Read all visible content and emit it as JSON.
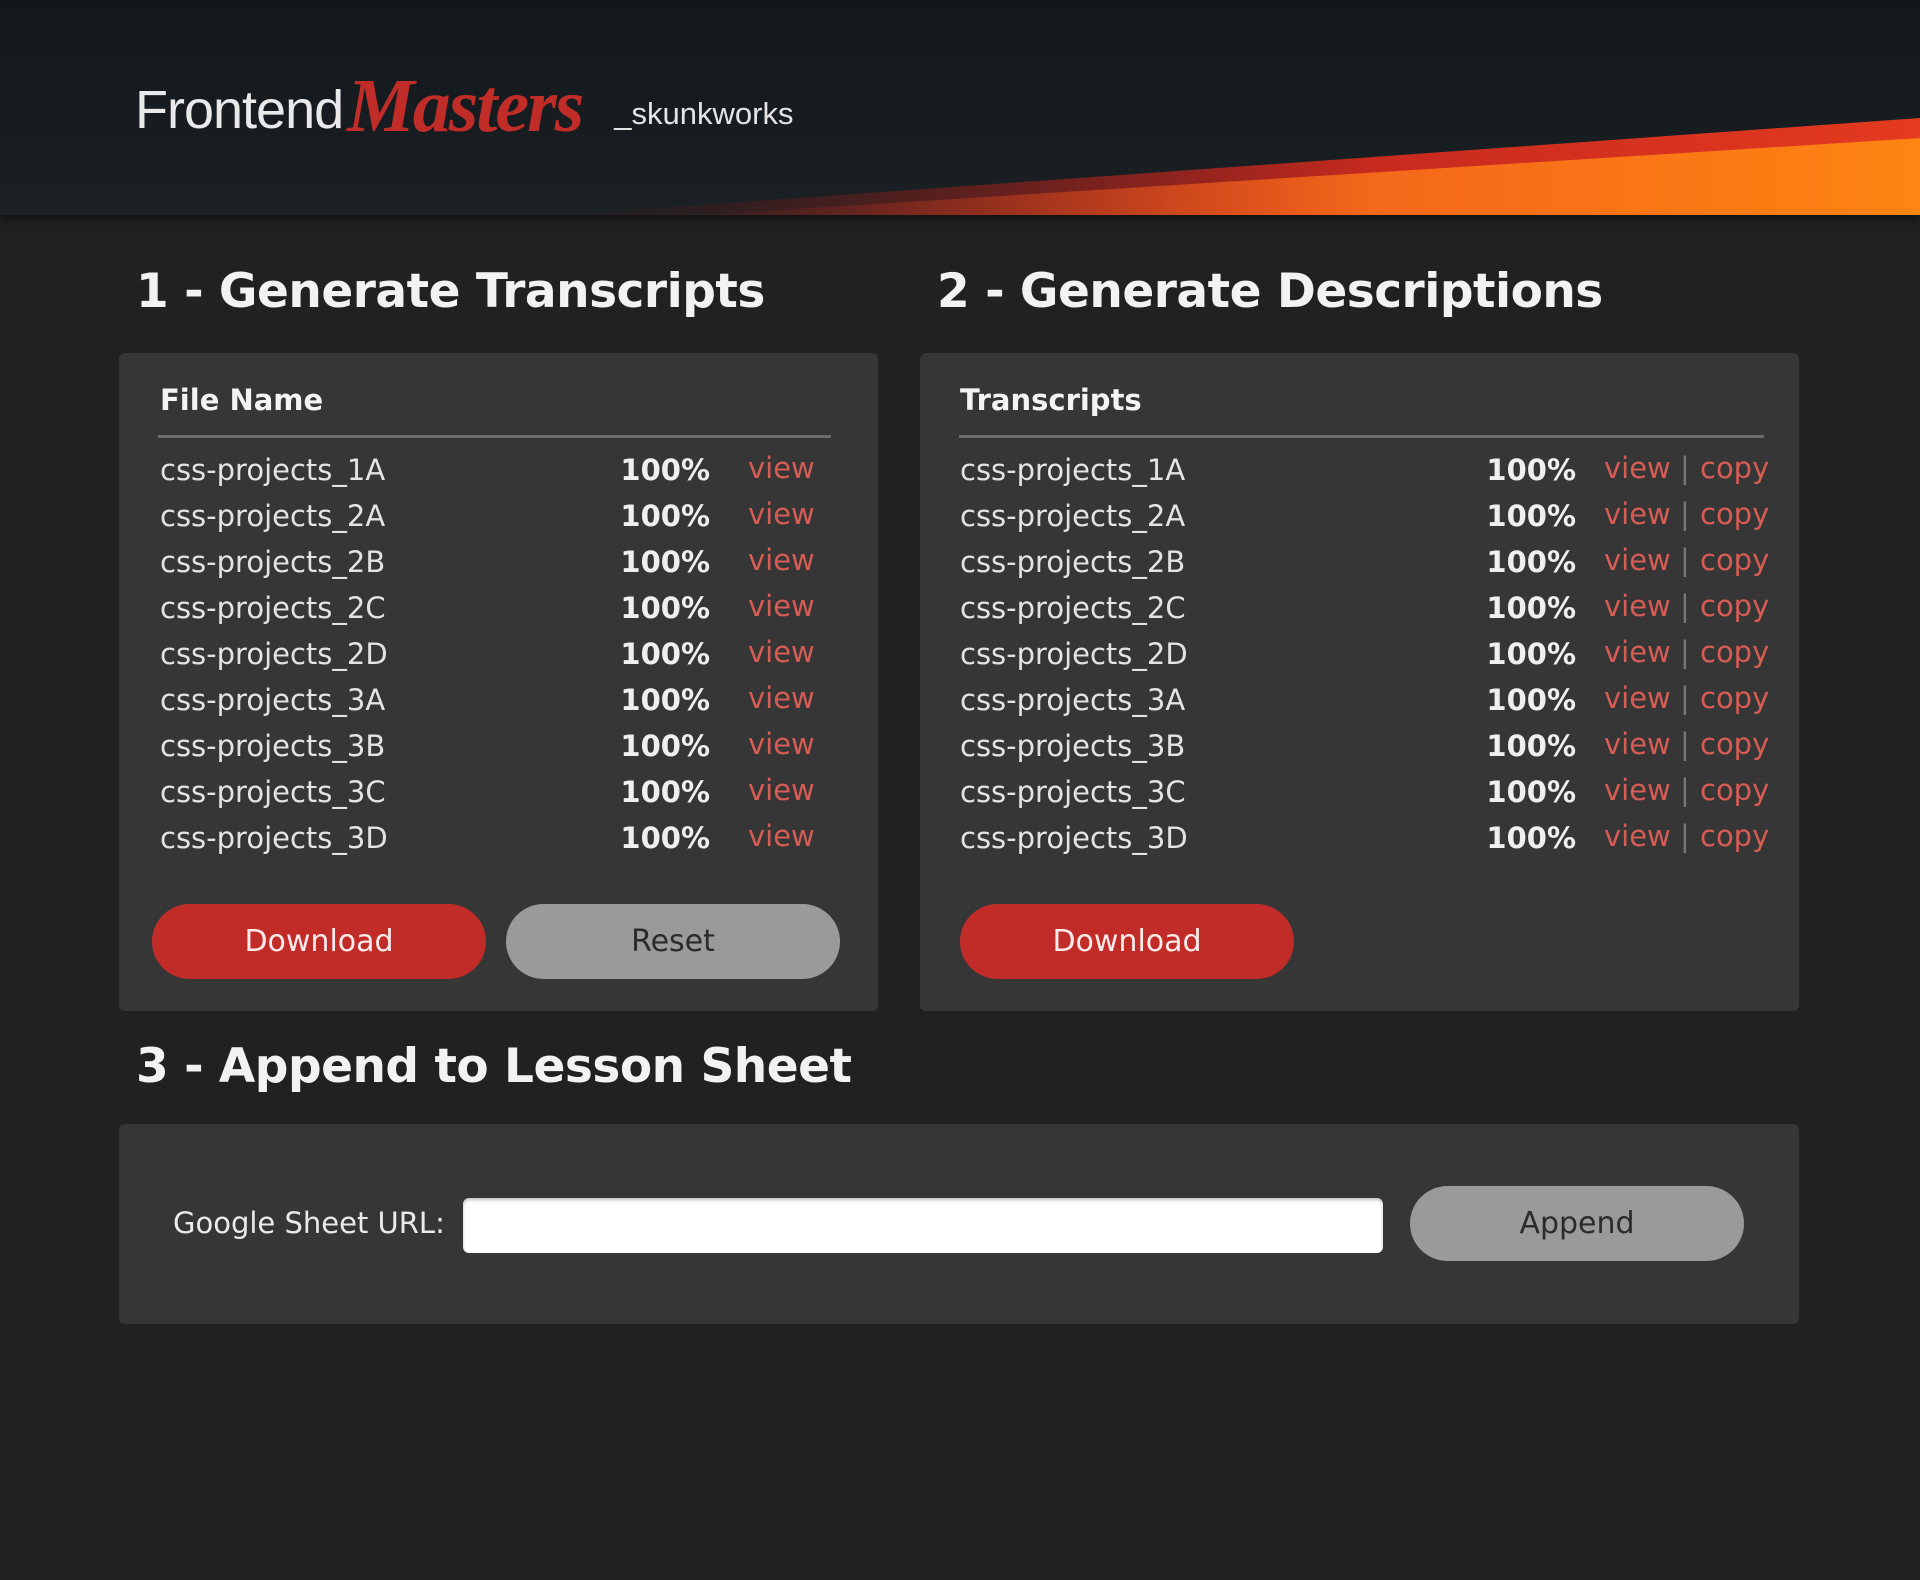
{
  "brand": {
    "frontend": "Frontend",
    "masters": "Masters",
    "suffix": "_skunkworks",
    "accent": "#c22c28",
    "swoosh": [
      "#c0281f",
      "#f4681a",
      "#ff8412"
    ]
  },
  "sections": {
    "transcripts": {
      "title": "1 - Generate Transcripts",
      "column_header": "File Name",
      "rows": [
        {
          "name": "css-projects_1A",
          "progress": "100%",
          "view": "view"
        },
        {
          "name": "css-projects_2A",
          "progress": "100%",
          "view": "view"
        },
        {
          "name": "css-projects_2B",
          "progress": "100%",
          "view": "view"
        },
        {
          "name": "css-projects_2C",
          "progress": "100%",
          "view": "view"
        },
        {
          "name": "css-projects_2D",
          "progress": "100%",
          "view": "view"
        },
        {
          "name": "css-projects_3A",
          "progress": "100%",
          "view": "view"
        },
        {
          "name": "css-projects_3B",
          "progress": "100%",
          "view": "view"
        },
        {
          "name": "css-projects_3C",
          "progress": "100%",
          "view": "view"
        },
        {
          "name": "css-projects_3D",
          "progress": "100%",
          "view": "view"
        }
      ],
      "download_label": "Download",
      "reset_label": "Reset"
    },
    "descriptions": {
      "title": "2 - Generate Descriptions",
      "column_header": "Transcripts",
      "rows": [
        {
          "name": "css-projects_1A",
          "progress": "100%",
          "view": "view",
          "sep": "|",
          "copy": "copy"
        },
        {
          "name": "css-projects_2A",
          "progress": "100%",
          "view": "view",
          "sep": "|",
          "copy": "copy"
        },
        {
          "name": "css-projects_2B",
          "progress": "100%",
          "view": "view",
          "sep": "|",
          "copy": "copy"
        },
        {
          "name": "css-projects_2C",
          "progress": "100%",
          "view": "view",
          "sep": "|",
          "copy": "copy"
        },
        {
          "name": "css-projects_2D",
          "progress": "100%",
          "view": "view",
          "sep": "|",
          "copy": "copy"
        },
        {
          "name": "css-projects_3A",
          "progress": "100%",
          "view": "view",
          "sep": "|",
          "copy": "copy"
        },
        {
          "name": "css-projects_3B",
          "progress": "100%",
          "view": "view",
          "sep": "|",
          "copy": "copy"
        },
        {
          "name": "css-projects_3C",
          "progress": "100%",
          "view": "view",
          "sep": "|",
          "copy": "copy"
        },
        {
          "name": "css-projects_3D",
          "progress": "100%",
          "view": "view",
          "sep": "|",
          "copy": "copy"
        }
      ],
      "download_label": "Download"
    },
    "append": {
      "title": "3 - Append to Lesson Sheet",
      "url_label": "Google Sheet URL:",
      "url_value": "",
      "url_placeholder": "",
      "append_label": "Append"
    }
  }
}
